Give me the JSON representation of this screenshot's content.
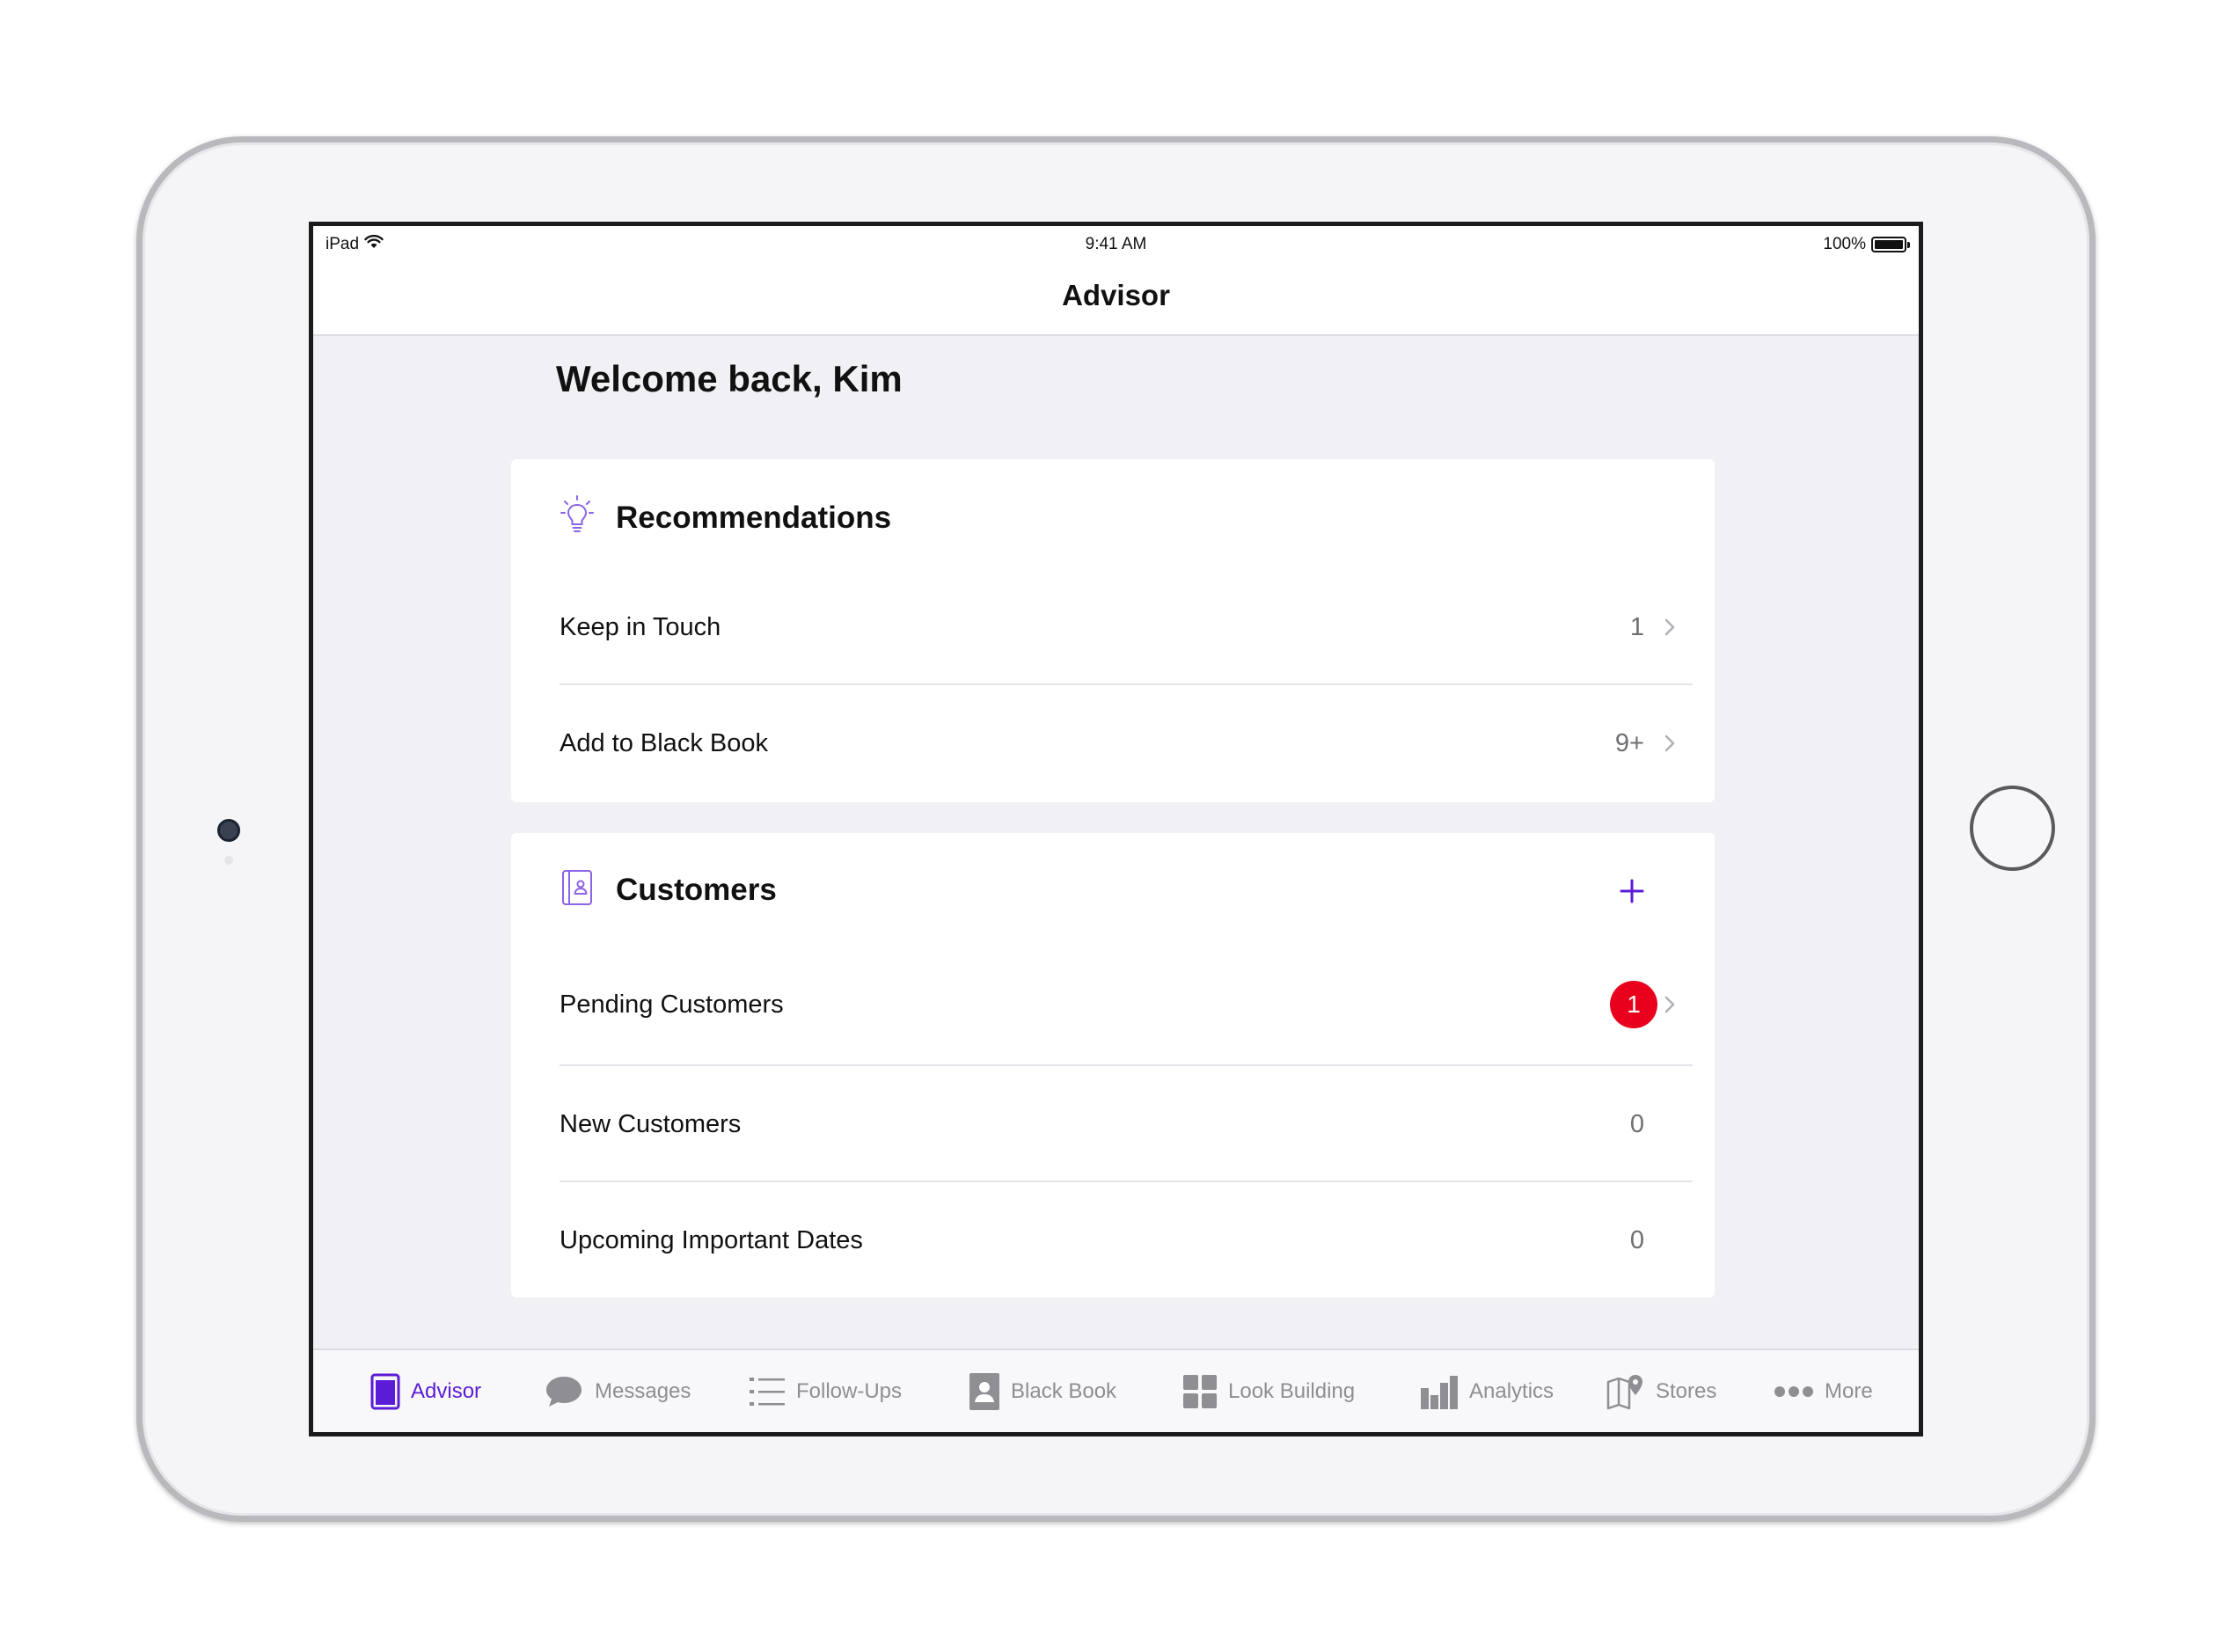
{
  "status_bar": {
    "device": "iPad",
    "time": "9:41 AM",
    "battery": "100%",
    "battery_level": 1.0
  },
  "nav": {
    "title": "Advisor"
  },
  "welcome": "Welcome back, Kim",
  "recommendations": {
    "title": "Recommendations",
    "icon": "lightbulb-icon",
    "rows": [
      {
        "label": "Keep in Touch",
        "value": "1"
      },
      {
        "label": "Add to Black Book",
        "value": "9+"
      }
    ]
  },
  "customers": {
    "title": "Customers",
    "icon": "contacts-book-icon",
    "add_icon": "plus-icon",
    "rows": [
      {
        "label": "Pending Customers",
        "badge": "1"
      },
      {
        "label": "New Customers",
        "value": "0"
      },
      {
        "label": "Upcoming Important Dates",
        "value": "0"
      }
    ]
  },
  "tab_bar": {
    "tabs": [
      {
        "label": "Advisor",
        "icon": "advisor-book-icon",
        "active": true
      },
      {
        "label": "Messages",
        "icon": "chat-bubble-icon",
        "active": false
      },
      {
        "label": "Follow-Ups",
        "icon": "list-icon",
        "active": false
      },
      {
        "label": "Black Book",
        "icon": "contact-card-icon",
        "active": false
      },
      {
        "label": "Look Building",
        "icon": "grid-icon",
        "active": false
      },
      {
        "label": "Analytics",
        "icon": "bar-chart-icon",
        "active": false
      },
      {
        "label": "Stores",
        "icon": "map-pin-icon",
        "active": false
      },
      {
        "label": "More",
        "icon": "more-dots-icon",
        "active": false
      }
    ]
  },
  "colors": {
    "accent": "#5a1cd6",
    "badge": "#e8001c",
    "background": "#f0f0f5"
  }
}
